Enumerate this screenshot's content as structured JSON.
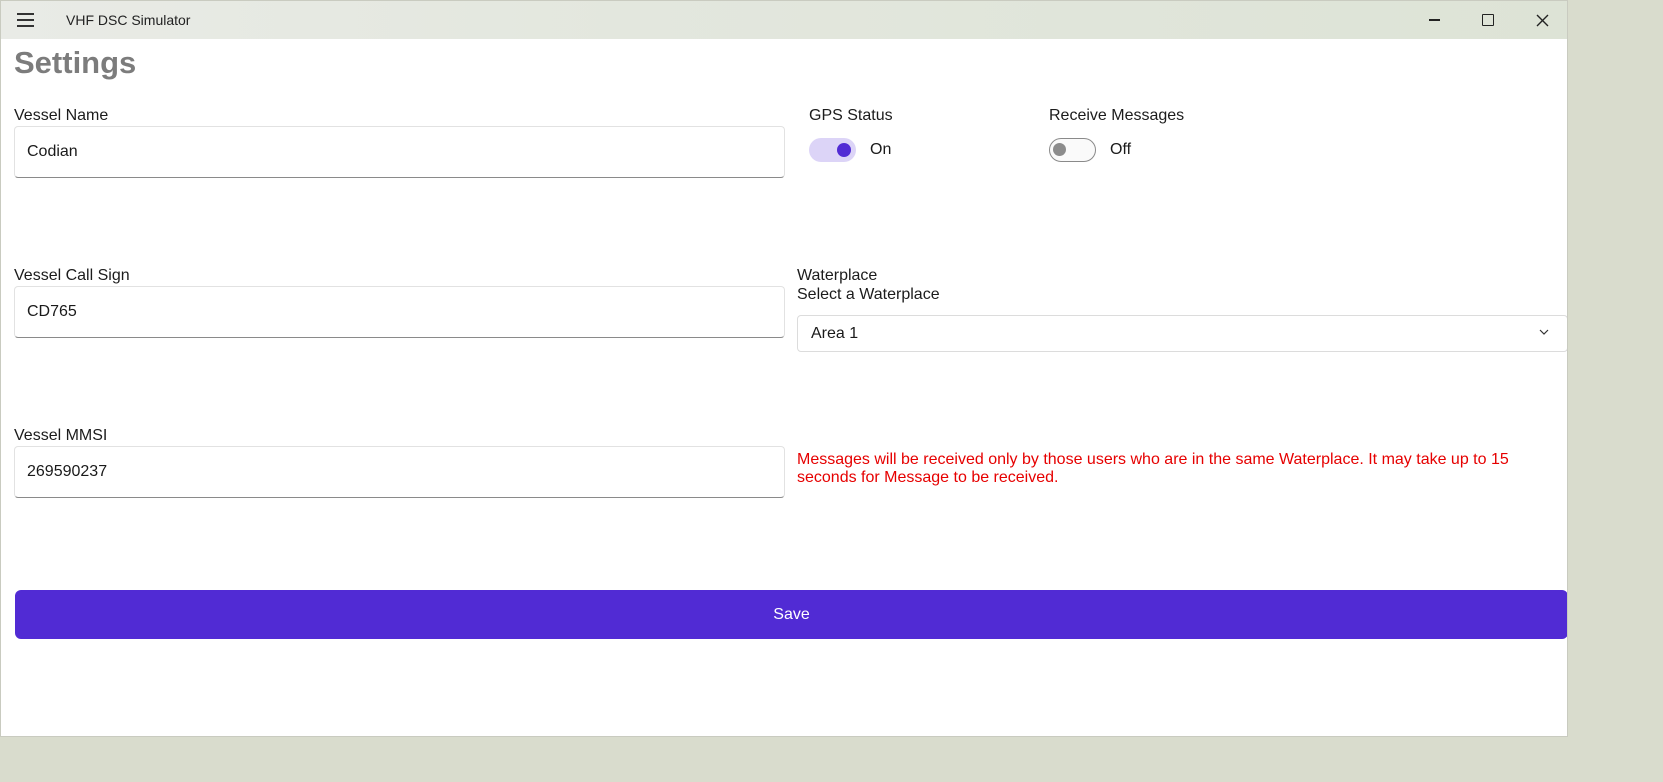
{
  "window": {
    "title": "VHF DSC Simulator"
  },
  "page": {
    "title": "Settings"
  },
  "vessel_name": {
    "label": "Vessel Name",
    "value": "Codian"
  },
  "vessel_call_sign": {
    "label": "Vessel Call Sign",
    "value": "CD765"
  },
  "vessel_mmsi": {
    "label": "Vessel MMSI",
    "value": "269590237"
  },
  "gps_status": {
    "label": "GPS Status",
    "state_text": "On",
    "checked": true
  },
  "receive_messages": {
    "label": "Receive Messages",
    "state_text": "Off",
    "checked": false
  },
  "waterplace": {
    "label": "Waterplace",
    "picker_title": "Select a Waterplace",
    "selected": "Area 1"
  },
  "notice": {
    "text": "Messages will be received only by those users who are in the same Waterplace. It may take up to 15 seconds for Message to be received."
  },
  "save": {
    "label": "Save"
  },
  "colors": {
    "accent": "#512bd4",
    "notice": "#e60000",
    "title_gray": "#7c7c7c"
  }
}
